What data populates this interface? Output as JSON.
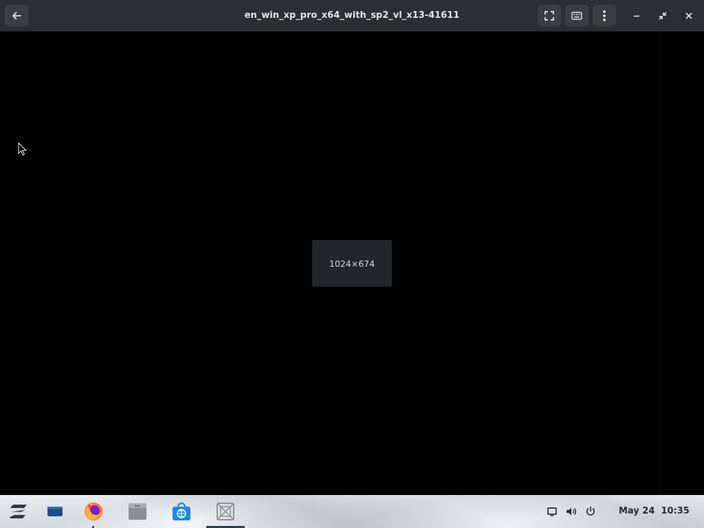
{
  "header": {
    "title": "en_win_xp_pro_x64_with_sp2_vl_x13-41611",
    "back_icon": "arrow-left-icon",
    "fullscreen_icon": "fullscreen-icon",
    "keyboard_icon": "keyboard-icon",
    "menu_icon": "vertical-dots-icon",
    "minimize_icon": "minimize-icon",
    "restore_icon": "restore-icon",
    "close_icon": "close-icon"
  },
  "viewer": {
    "resolution_text": "1024×674"
  },
  "taskbar": {
    "apps": [
      {
        "name": "zorin-menu",
        "icon": "zorin-logo-icon"
      },
      {
        "name": "window-switcher",
        "icon": "windows-icon"
      },
      {
        "name": "firefox",
        "icon": "firefox-icon"
      },
      {
        "name": "files",
        "icon": "folder-icon"
      },
      {
        "name": "software-store",
        "icon": "store-icon"
      },
      {
        "name": "virtual-machine-app",
        "icon": "vm-icon"
      }
    ],
    "tray": {
      "display_icon": "display-icon",
      "volume_icon": "volume-icon",
      "power_icon": "power-icon"
    },
    "clock": "May 24  10:35"
  },
  "colors": {
    "header_bg": "#2b2e33",
    "viewer_bg": "#000000",
    "overlay_bg": "#222529",
    "store_blue": "#1e88e5",
    "firefox_orange": "#ff7139"
  }
}
